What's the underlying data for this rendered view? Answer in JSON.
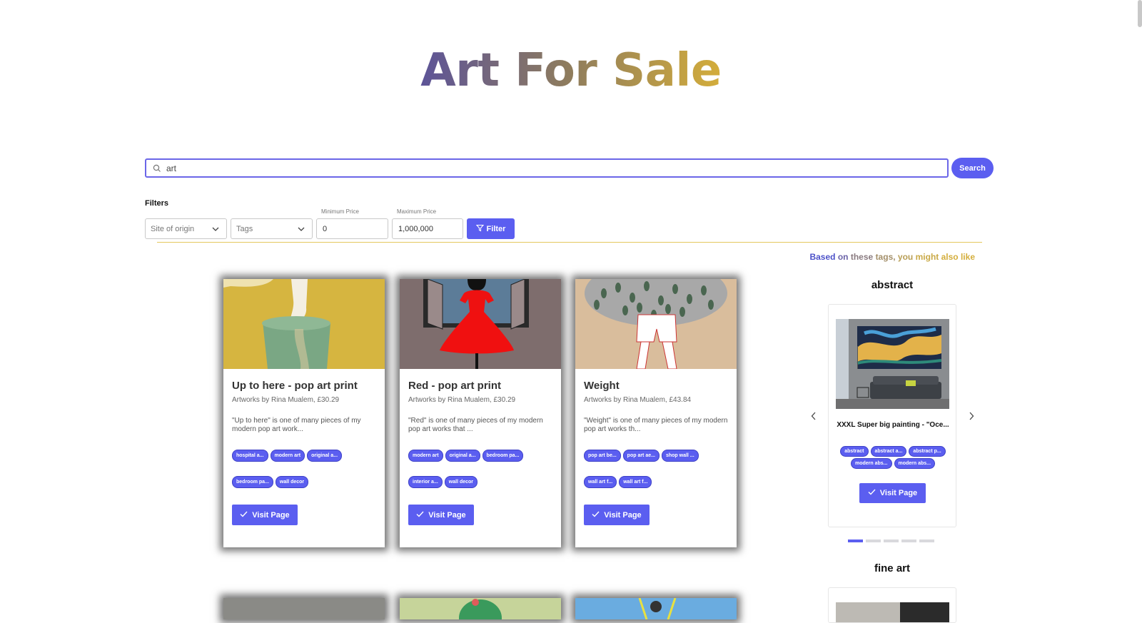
{
  "page": {
    "title": "Art For Sale"
  },
  "search": {
    "value": "art",
    "button_label": "Search"
  },
  "filters": {
    "label": "Filters",
    "site_of_origin_placeholder": "Site of origin",
    "tags_placeholder": "Tags",
    "min_price_label": "Minimum Price",
    "min_price_value": "0",
    "max_price_label": "Maximum Price",
    "max_price_value": "1,000,000",
    "filter_button_label": "Filter"
  },
  "recommendations": {
    "heading_words": [
      "Based",
      "on",
      "these",
      "tags,",
      "you",
      "might",
      "also like"
    ],
    "categories": [
      {
        "name": "abstract",
        "item": {
          "title": "XXXL Super big painting - \"Oce...",
          "tags": [
            "abstract",
            "abstract a...",
            "abstract p...",
            "modern abs...",
            "modern abs..."
          ],
          "visit_label": "Visit Page"
        },
        "dots": 5,
        "active_dot": 0
      },
      {
        "name": "fine art"
      }
    ]
  },
  "products": [
    {
      "title": "Up to here - pop art print",
      "subtitle": "Artworks by Rina Mualem, £30.29",
      "description": "\"Up to here\" is one of many pieces of my modern pop art work...",
      "tags_row1": [
        "hospital a...",
        "modern art",
        "original a..."
      ],
      "tags_row2": [
        "bedroom pa...",
        "wall decor"
      ],
      "visit_label": "Visit Page"
    },
    {
      "title": "Red - pop art print",
      "subtitle": "Artworks by Rina Mualem, £30.29",
      "description": "\"Red\" is one of many pieces of my modern pop art works that ...",
      "tags_row1": [
        "modern art",
        "original a...",
        "bedroom pa..."
      ],
      "tags_row2": [
        "interior a...",
        "wall decor"
      ],
      "visit_label": "Visit Page"
    },
    {
      "title": "Weight",
      "subtitle": "Artworks by Rina Mualem, £43.84",
      "description": "\"Weight\" is one of many pieces of my modern pop art works th...",
      "tags_row1": [
        "pop art be...",
        "pop art ae...",
        "shop wall ..."
      ],
      "tags_row2": [
        "wall art f...",
        "wall art f..."
      ],
      "visit_label": "Visit Page"
    }
  ],
  "colors": {
    "accent": "#5b5ef0",
    "gold": "#d5ae3a",
    "purple": "#5c5399"
  }
}
